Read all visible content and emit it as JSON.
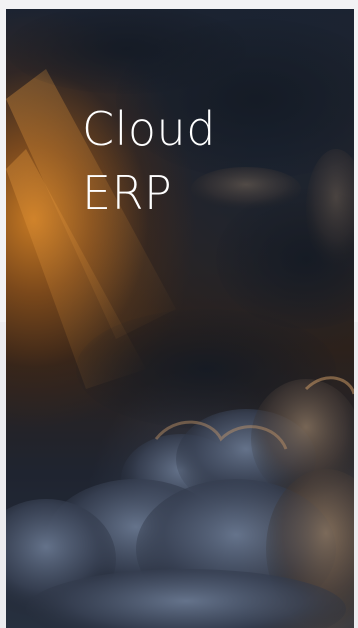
{
  "hero": {
    "title_line1": "Cloud",
    "title_line2": "ERP"
  }
}
